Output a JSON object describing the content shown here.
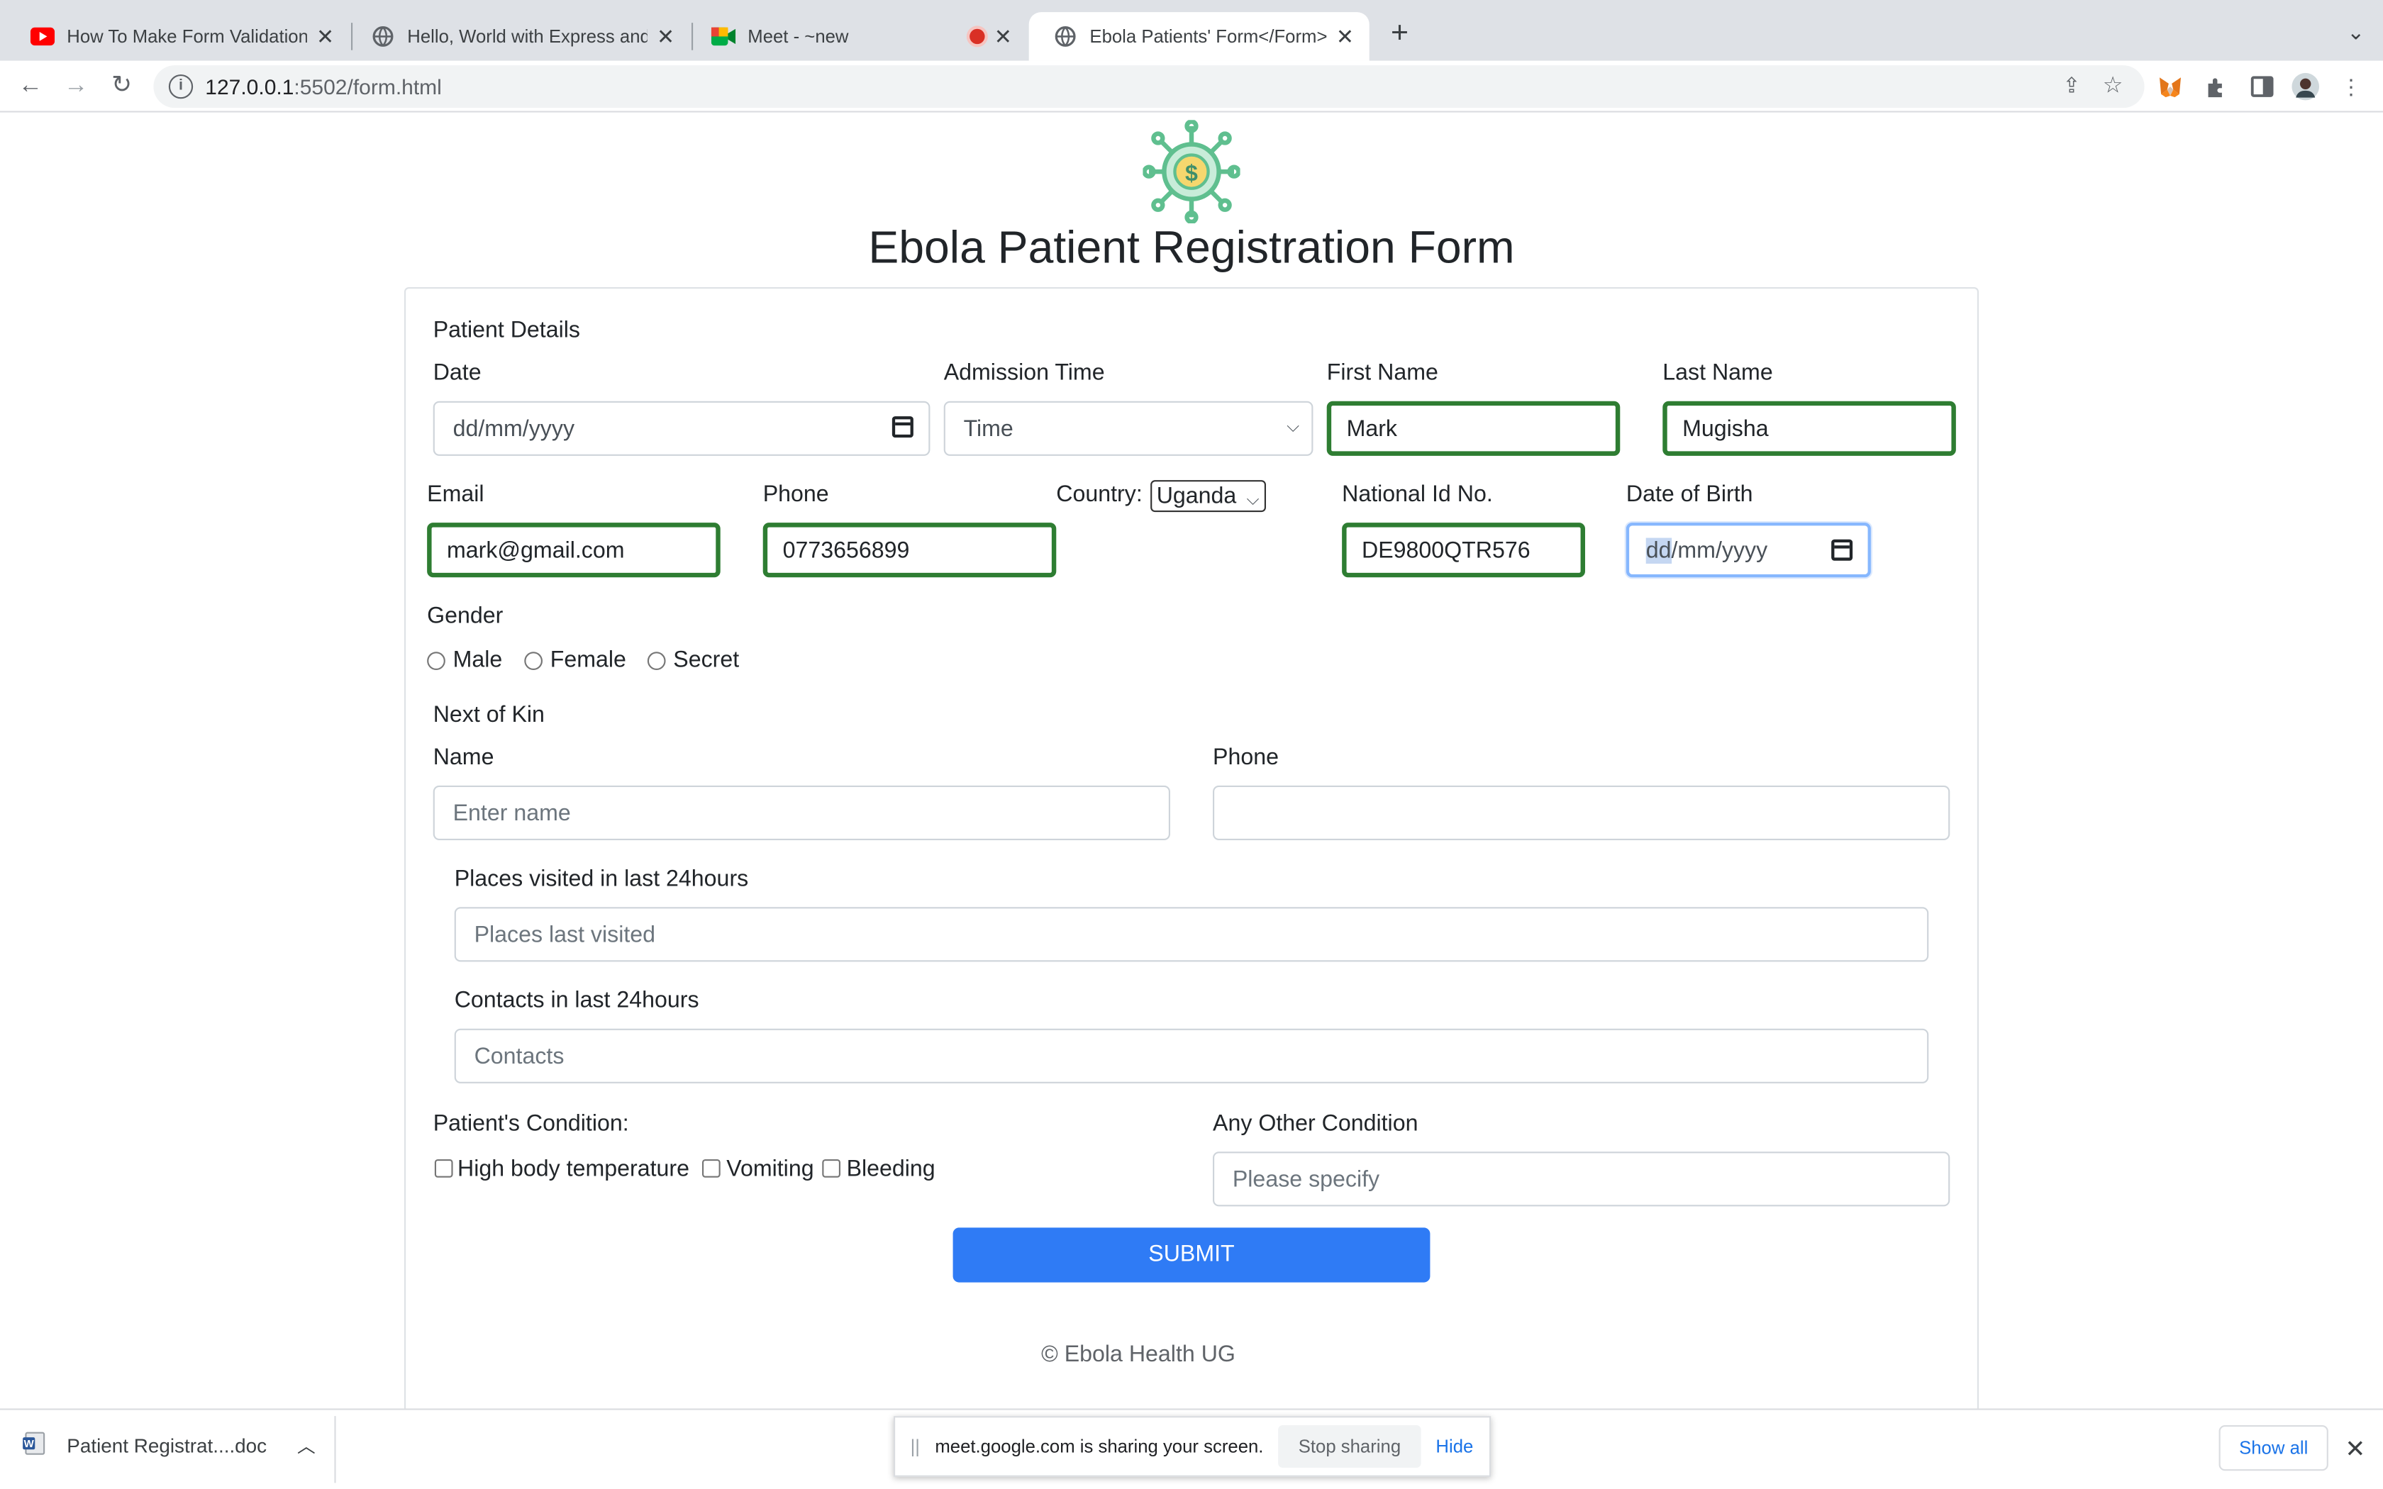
{
  "browser": {
    "tabs": [
      {
        "title": "How To Make Form Validation U",
        "icon": "youtube-icon",
        "active": false
      },
      {
        "title": "Hello, World with Express and",
        "icon": "globe-icon",
        "active": false
      },
      {
        "title": "Meet - ~new",
        "icon": "google-meet-icon",
        "active": false,
        "recording": true
      },
      {
        "title": "Ebola Patients' Form</Form>",
        "icon": "globe-icon",
        "active": true
      }
    ],
    "url_host": "127.0.0.1",
    "url_path": ":5502/form.html"
  },
  "page": {
    "title": "Ebola Patient Registration Form",
    "logo_icon": "virus-dollar-icon",
    "patient_details": {
      "section_label": "Patient Details",
      "date_label": "Date",
      "date_value": "dd/mm/yyyy",
      "admission_label": "Admission Time",
      "admission_value": "Time",
      "first_name_label": "First Name",
      "first_name_value": "Mark",
      "last_name_label": "Last Name",
      "last_name_value": "Mugisha",
      "email_label": "Email",
      "email_value": "mark@gmail.com",
      "phone_label": "Phone",
      "phone_value": "0773656899",
      "country_label": "Country:",
      "country_value": "Uganda",
      "national_id_label": "National Id No.",
      "national_id_value": "DE9800QTR576",
      "dob_label": "Date of Birth",
      "dob_value_dd": "dd",
      "dob_value_rest": "/mm/yyyy",
      "gender_label": "Gender",
      "gender_options": [
        "Male",
        "Female",
        "Secret"
      ]
    },
    "next_of_kin": {
      "section_label": "Next of Kin",
      "name_label": "Name",
      "name_placeholder": "Enter name",
      "phone_label": "Phone",
      "phone_value": ""
    },
    "places_label": "Places visited in last 24hours",
    "places_placeholder": "Places last visited",
    "contacts_label": "Contacts in last 24hours",
    "contacts_placeholder": "Contacts",
    "condition_label": "Patient's Condition:",
    "conditions": [
      "High body temperature",
      "Vomiting",
      "Bleeding"
    ],
    "other_condition_label": "Any Other Condition",
    "other_condition_placeholder": "Please specify",
    "submit_label": "SUBMIT",
    "footer": "© Ebola Health UG"
  },
  "download_bar": {
    "file_name": "Patient Registrat....doc",
    "share_message": "meet.google.com is sharing your screen.",
    "stop_sharing": "Stop sharing",
    "hide": "Hide",
    "show_all": "Show all"
  },
  "colors": {
    "valid_border": "#2e7d32",
    "submit_bg": "#2f7bf5",
    "focus_border": "#86b7fe"
  }
}
